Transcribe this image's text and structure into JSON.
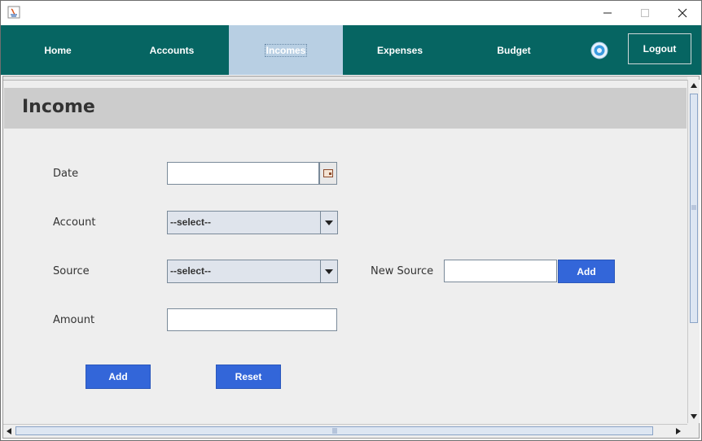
{
  "window": {
    "minimize_icon": "minimize-icon",
    "maximize_icon": "maximize-icon",
    "close_icon": "close-icon"
  },
  "nav": {
    "items": [
      {
        "label": "Home"
      },
      {
        "label": "Accounts"
      },
      {
        "label": "Incomes"
      },
      {
        "label": "Expenses"
      },
      {
        "label": "Budget"
      }
    ],
    "active": "Incomes",
    "logout_label": "Logout"
  },
  "page": {
    "title": "Income"
  },
  "form": {
    "date_label": "Date",
    "date_value": "",
    "account_label": "Account",
    "account_selected": "--select--",
    "source_label": "Source",
    "source_selected": "--select--",
    "new_source_label": "New Source",
    "new_source_value": "",
    "new_source_add_label": "Add",
    "amount_label": "Amount",
    "amount_value": "",
    "add_label": "Add",
    "reset_label": "Reset"
  },
  "colors": {
    "nav_bg": "#066562",
    "nav_active": "#b8cfe3",
    "button_blue": "#3366d9",
    "header_bg": "#cccccc"
  }
}
